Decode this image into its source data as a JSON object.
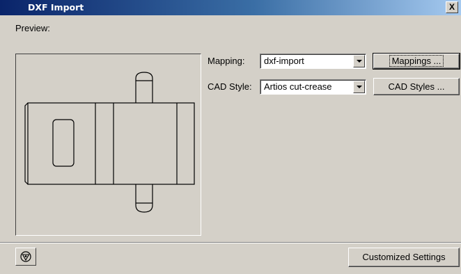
{
  "window": {
    "title": "DXF Import",
    "close_glyph": "X"
  },
  "preview": {
    "label": "Preview:"
  },
  "mapping": {
    "label": "Mapping:",
    "value": "dxf-import",
    "button": "Mappings ..."
  },
  "cad_style": {
    "label": "CAD Style:",
    "value": "Artios cut-crease",
    "button": "CAD Styles ..."
  },
  "footer": {
    "icon": "settings-gear-icon",
    "customized_button": "Customized Settings"
  },
  "colors": {
    "titlebar_start": "#0a246a",
    "titlebar_end": "#a6caf0",
    "dialog_bg": "#d4d0c8"
  }
}
